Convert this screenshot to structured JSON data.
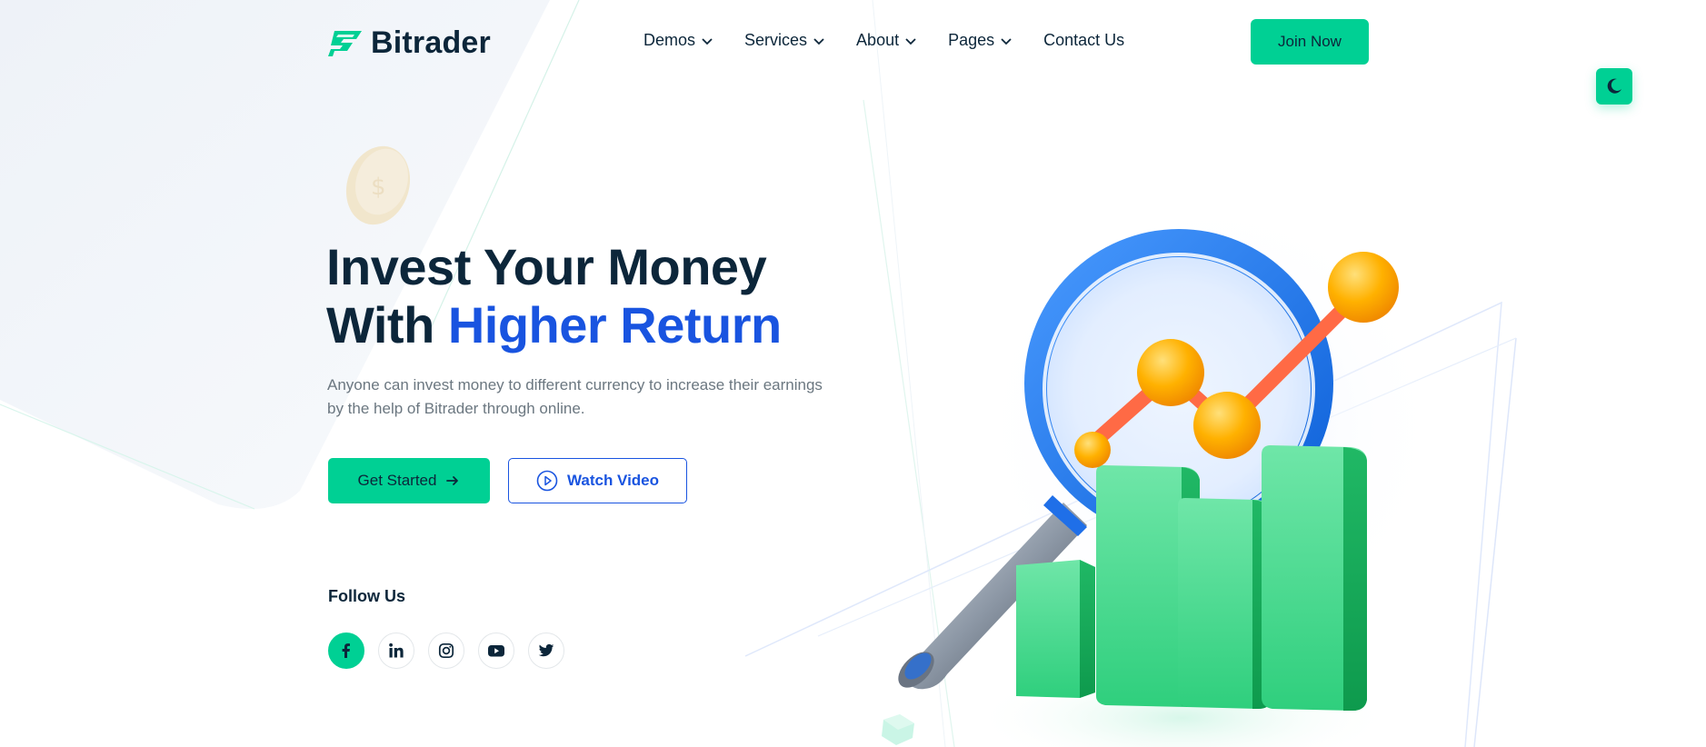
{
  "brand": {
    "name": "Bitrader",
    "color": "#00d094",
    "accent": "#1954e0",
    "dark": "#0c263a"
  },
  "nav": {
    "items": [
      {
        "label": "Demos",
        "has_dropdown": true
      },
      {
        "label": "Services",
        "has_dropdown": true
      },
      {
        "label": "About",
        "has_dropdown": true
      },
      {
        "label": "Pages",
        "has_dropdown": true
      },
      {
        "label": "Contact Us",
        "has_dropdown": false
      }
    ],
    "join_label": "Join Now"
  },
  "theme_toggle": {
    "icon": "moon-icon"
  },
  "hero": {
    "title_line1": "Invest Your Money",
    "title_line2_prefix": "With",
    "title_line2_accent": "Higher Return",
    "description": "Anyone can invest money to different currency to increase their earnings by the help of Bitrader through online.",
    "primary_button": "Get Started",
    "secondary_button": "Watch Video"
  },
  "follow": {
    "title": "Follow Us",
    "socials": [
      "facebook-icon",
      "linkedin-icon",
      "instagram-icon",
      "youtube-icon",
      "twitter-icon"
    ]
  }
}
